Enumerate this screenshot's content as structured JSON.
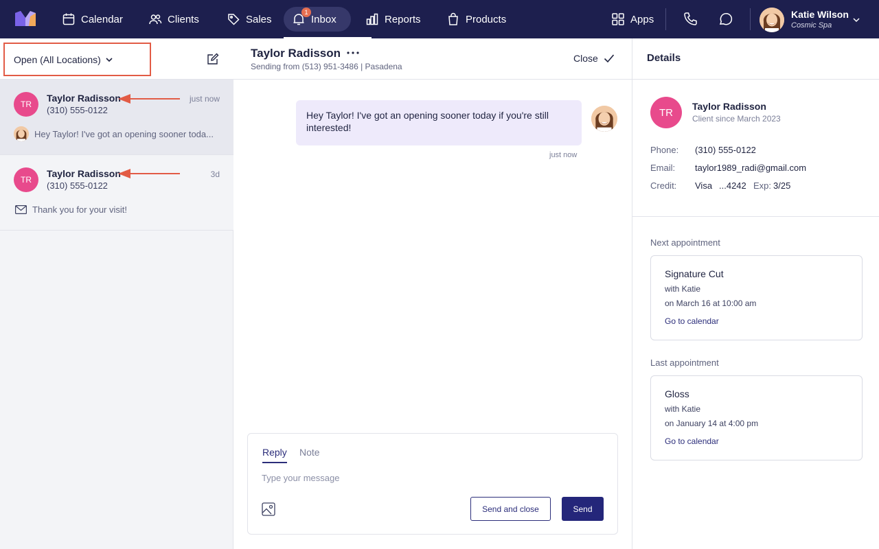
{
  "nav": {
    "items": [
      {
        "label": "Calendar",
        "icon": "calendar-icon"
      },
      {
        "label": "Clients",
        "icon": "clients-icon"
      },
      {
        "label": "Sales",
        "icon": "tag-icon"
      },
      {
        "label": "Inbox",
        "icon": "inbox-icon",
        "badge": "1",
        "active": true
      },
      {
        "label": "Reports",
        "icon": "bar-chart-icon"
      },
      {
        "label": "Products",
        "icon": "shopping-bag-icon"
      },
      {
        "label": "Apps",
        "icon": "grid-icon"
      }
    ],
    "user": {
      "name": "Katie Wilson",
      "org": "Cosmic Spa"
    },
    "colors": {
      "bar": "#1d1f4e",
      "badge": "#e76f51"
    }
  },
  "left": {
    "filter_label": "Open (All Locations)",
    "conversations": [
      {
        "initials": "TR",
        "name": "Taylor Radisson",
        "phone": "(310) 555-0122",
        "time": "just now",
        "preview": "Hey Taylor! I've got an opening sooner toda...",
        "preview_icon": "avatar"
      },
      {
        "initials": "TR",
        "name": "Taylor Radisson",
        "phone": "(310) 555-0122",
        "time": "3d",
        "preview": "Thank you for your visit!",
        "preview_icon": "mail-icon"
      }
    ]
  },
  "thread": {
    "name": "Taylor Radisson",
    "subtitle": "Sending from (513) 951-3486 | Pasadena",
    "close_label": "Close",
    "message": {
      "text": "Hey Taylor! I've got an opening sooner today if you're still interested!",
      "time": "just now"
    },
    "composer": {
      "tab_reply": "Reply",
      "tab_note": "Note",
      "placeholder": "Type your message",
      "send_close_label": "Send and close",
      "send_label": "Send"
    }
  },
  "details": {
    "title": "Details",
    "client": {
      "initials": "TR",
      "name": "Taylor Radisson",
      "since": "Client since March 2023"
    },
    "phone_label": "Phone:",
    "phone": "(310) 555-0122",
    "email_label": "Email:",
    "email": "taylor1989_radi@gmail.com",
    "credit_label": "Credit:",
    "credit_brand": "Visa",
    "credit_last4": "...4242",
    "exp_label": "Exp:",
    "exp": "3/25",
    "next": {
      "section": "Next appointment",
      "title": "Signature Cut",
      "with": "with Katie",
      "when": "on March 16 at 10:00 am",
      "link": "Go to calendar"
    },
    "last": {
      "section": "Last appointment",
      "title": "Gloss",
      "with": "with Katie",
      "when": "on January 14 at 4:00 pm",
      "link": "Go to calendar"
    },
    "colors": {
      "avatar": "#e84a8c",
      "accent": "#2b2d7a"
    }
  }
}
